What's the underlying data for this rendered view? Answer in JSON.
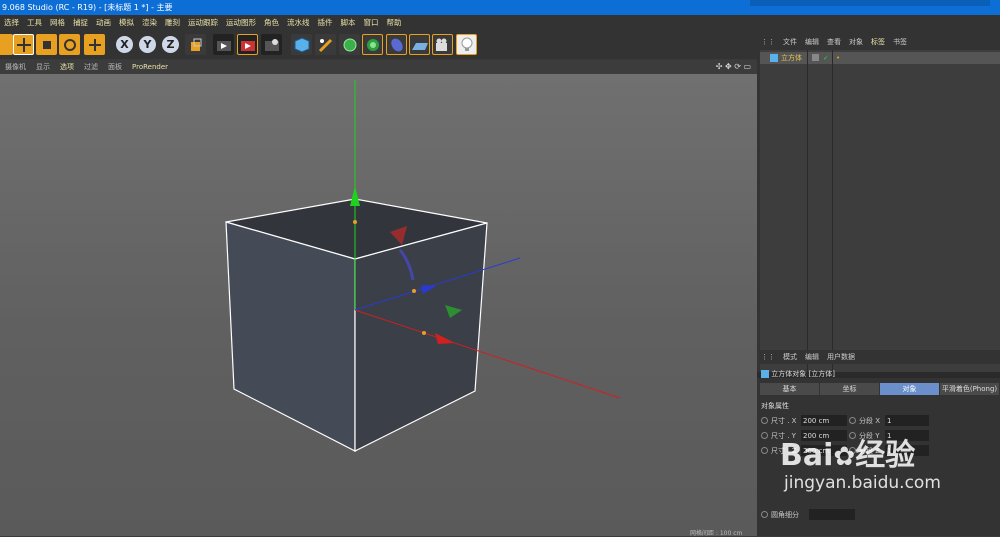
{
  "window": {
    "title": "9.068 Studio (RC - R19) - [未标题 1 *] - 主要"
  },
  "menu": [
    "选择",
    "工具",
    "网格",
    "捕捉",
    "动画",
    "模拟",
    "渲染",
    "雕刻",
    "运动跟踪",
    "运动图形",
    "角色",
    "流水线",
    "插件",
    "脚本",
    "窗口",
    "帮助"
  ],
  "toolbar": {
    "axis_x": "X",
    "axis_y": "Y",
    "axis_z": "Z"
  },
  "viewport": {
    "menu": [
      "摄像机",
      "显示",
      "选项",
      "过滤",
      "面板",
      "ProRender"
    ],
    "icons": "✣ ✥ ⟳ ▭"
  },
  "object_manager": {
    "menu": [
      "文件",
      "编辑",
      "查看",
      "对象",
      "标签",
      "书签"
    ],
    "objects": [
      {
        "name": "立方体"
      }
    ]
  },
  "attribute_manager": {
    "menu": [
      "模式",
      "编辑",
      "用户数据"
    ],
    "title": "立方体对象 [立方体]",
    "tabs": [
      "基本",
      "坐标",
      "对象",
      "平滑着色(Phong)"
    ],
    "selected_tab": "对象",
    "section": "对象属性",
    "rows": [
      {
        "label": "尺寸 . X",
        "value": "200 cm",
        "seg_label": "分段 X",
        "seg_value": "1"
      },
      {
        "label": "尺寸 . Y",
        "value": "200 cm",
        "seg_label": "分段 Y",
        "seg_value": "1"
      },
      {
        "label": "尺寸 . Z",
        "value": "200 cm",
        "seg_label": "分段 Z",
        "seg_value": "1"
      }
    ],
    "extra": "圆角细分"
  },
  "status": {
    "text": "网格间距 : 100 cm"
  },
  "watermark": {
    "brand": "Bai",
    "brand2": "经验",
    "url": "jingyan.baidu.com"
  },
  "colors": {
    "accent": "#0d6fd6",
    "menu_text": "#e8e0a8",
    "x_axis": "#d02020",
    "y_axis": "#1ed21e",
    "z_axis": "#2a3ad0"
  }
}
